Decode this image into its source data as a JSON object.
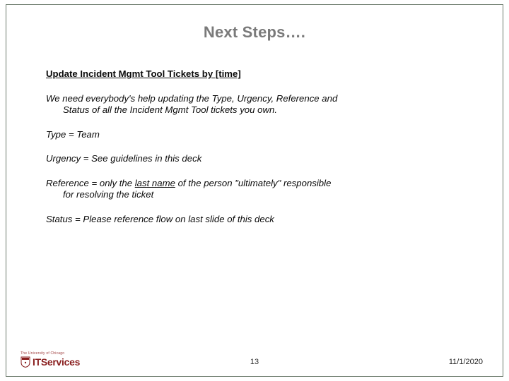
{
  "slide": {
    "title": "Next Steps….",
    "heading": "Update Incident Mgmt Tool Tickets by [time]",
    "intro_line1": "We need everybody's help updating the Type, Urgency, Reference and",
    "intro_line2": "Status of all the Incident Mgmt Tool tickets you own.",
    "type_line": "Type = Team",
    "urgency_line": "Urgency = See guidelines in this deck",
    "reference_pre": "Reference = only the ",
    "reference_underlined": "last name",
    "reference_post": " of the person \"ultimately\" responsible",
    "reference_line2": "for resolving the ticket",
    "status_line": "Status = Please reference flow on last slide of this deck"
  },
  "footer": {
    "logo_top": "The University of Chicago",
    "logo_text_bold": "IT",
    "logo_text_rest": "Services",
    "page_number": "13",
    "date": "11/1/2020"
  },
  "colors": {
    "border": "#6b7a6b",
    "title": "#7a7a7a",
    "brand": "#8a1f1f"
  }
}
